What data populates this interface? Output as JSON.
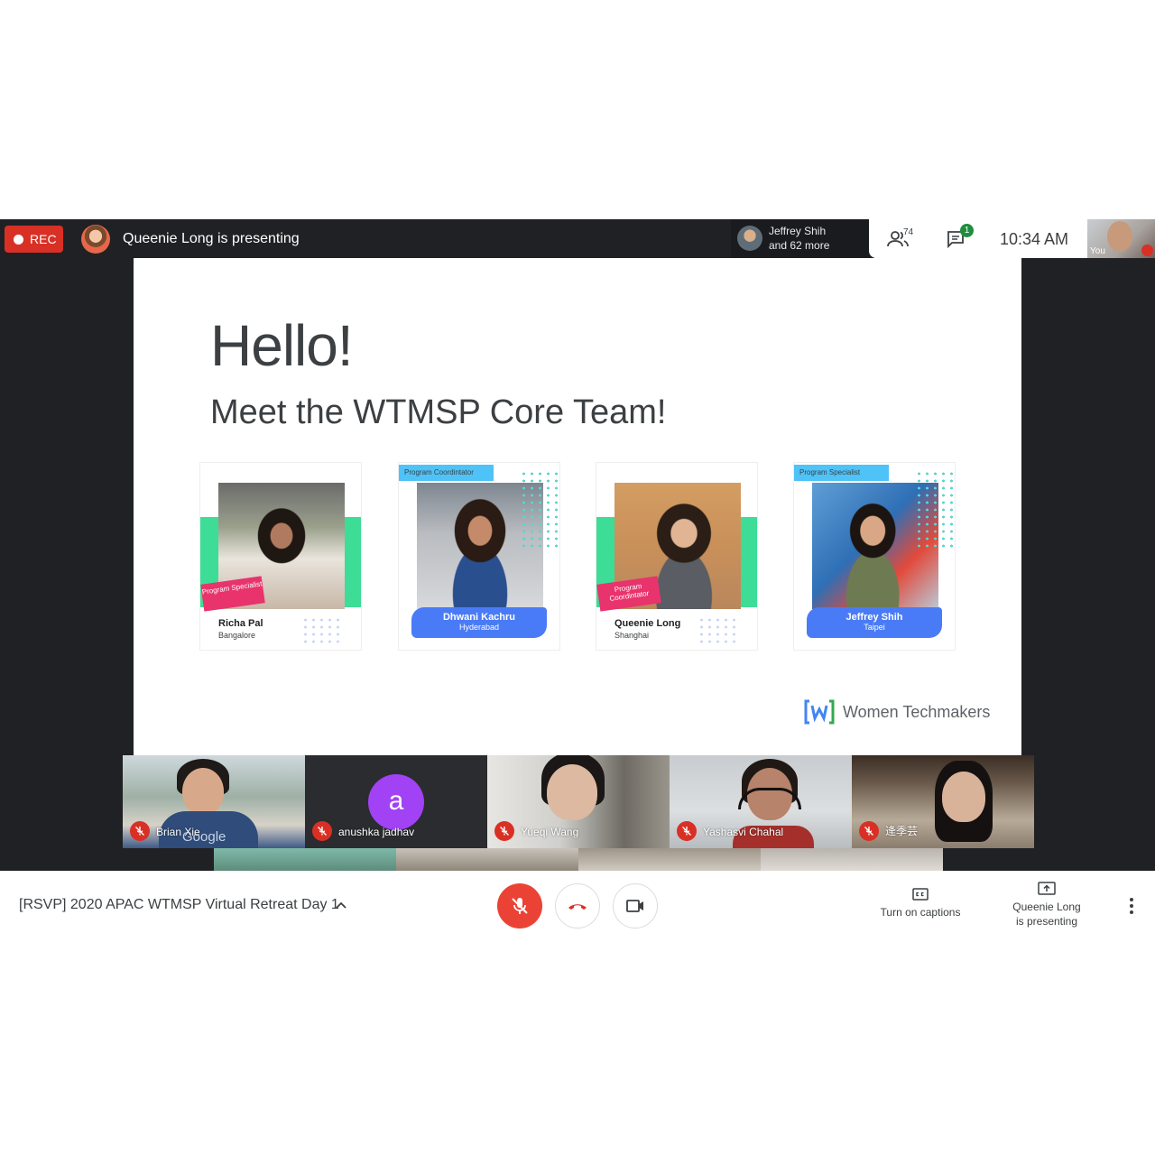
{
  "top_bar": {
    "rec_label": "REC",
    "presenting_text": "Queenie Long is presenting",
    "join_toast_line1": "Jeffrey Shih",
    "join_toast_line2": "and 62 more",
    "people_count": "74",
    "chat_badge": "1",
    "clock": "10:34  AM",
    "self_label": "You"
  },
  "slide": {
    "title": "Hello!",
    "subtitle": "Meet the WTMSP Core Team!",
    "cards": [
      {
        "role": "Program Specialist",
        "name": "Richa Pal",
        "city": "Bangalore"
      },
      {
        "role": "Program Coordintator",
        "name": "Dhwani Kachru",
        "city": "Hyderabad"
      },
      {
        "role": "Program Coordintator",
        "name": "Queenie Long",
        "city": "Shanghai"
      },
      {
        "role": "Program Specialist",
        "name": "Jeffrey Shih",
        "city": "Taipei"
      }
    ],
    "brand": "Women Techmakers",
    "brand_accent": "#4285f4"
  },
  "participants": [
    {
      "name": "Brian Xie",
      "shirt_text": "Google"
    },
    {
      "name": "anushka jadhav",
      "avatar_letter": "a",
      "avatar_color": "#a142f4"
    },
    {
      "name": "Yueqi Wang"
    },
    {
      "name": "Yashasvi Chahal"
    },
    {
      "name": "逄季芸"
    }
  ],
  "bottom_bar": {
    "meeting_title": "[RSVP] 2020 APAC WTMSP Virtual Retreat Day 1",
    "captions_label": "Turn on captions",
    "present_label_line1": "Queenie Long",
    "present_label_line2": "is presenting",
    "mic_color": "#ea4335",
    "end_call_color": "#d93025"
  }
}
